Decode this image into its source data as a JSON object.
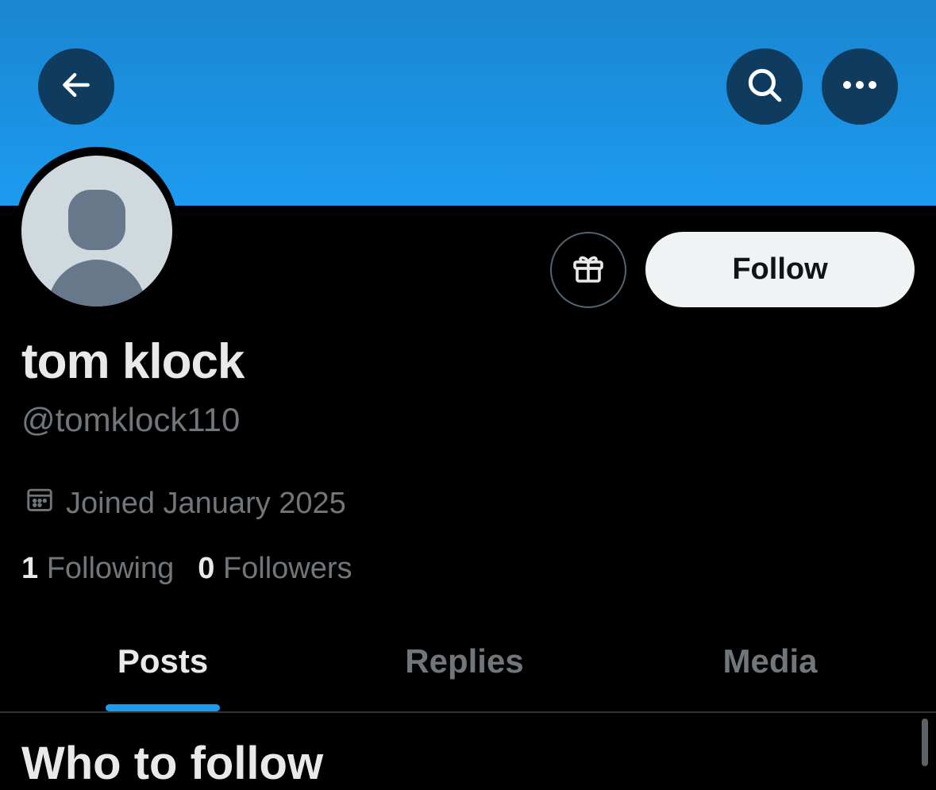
{
  "header": {
    "back_icon": "arrow-left-icon",
    "search_icon": "search-icon",
    "more_icon": "ellipsis-icon",
    "banner_color": "#1d9bf0"
  },
  "profile": {
    "display_name": "tom klock",
    "handle": "@tomklock110",
    "joined": "Joined January 2025",
    "following_count": "1",
    "following_label": "Following",
    "followers_count": "0",
    "followers_label": "Followers"
  },
  "actions": {
    "gift_icon": "gift-icon",
    "follow_label": "Follow"
  },
  "tabs": [
    {
      "label": "Posts",
      "active": true
    },
    {
      "label": "Replies",
      "active": false
    },
    {
      "label": "Media",
      "active": false
    }
  ],
  "section": {
    "heading": "Who to follow"
  },
  "colors": {
    "accent": "#1d9bf0",
    "background": "#000000",
    "muted_text": "#71767b"
  }
}
